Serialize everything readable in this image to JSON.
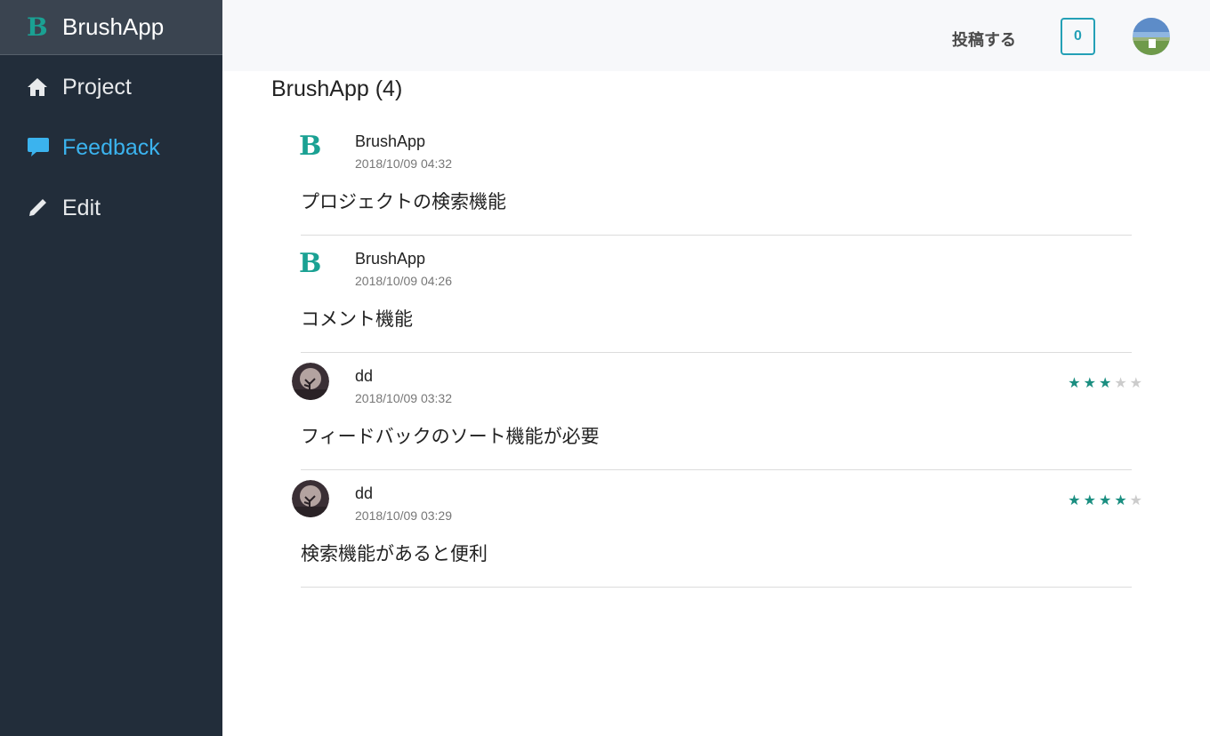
{
  "sidebar": {
    "brand": {
      "logo": "B",
      "name": "BrushApp"
    },
    "items": [
      {
        "label": "Project",
        "icon": "home-icon"
      },
      {
        "label": "Feedback",
        "icon": "chat-icon",
        "active": true
      },
      {
        "label": "Edit",
        "icon": "pencil-icon"
      }
    ]
  },
  "header": {
    "post_label": "投稿する",
    "counter": "0",
    "avatar_icon": "user-avatar"
  },
  "main": {
    "title": "BrushApp (4)",
    "feedback": [
      {
        "author": "BrushApp",
        "avatar": "B",
        "date": "2018/10/09 04:32",
        "text": "プロジェクトの検索機能",
        "rating": null
      },
      {
        "author": "BrushApp",
        "avatar": "B",
        "date": "2018/10/09 04:26",
        "text": "コメント機能",
        "rating": null
      },
      {
        "author": "dd",
        "avatar": "photo",
        "date": "2018/10/09 03:32",
        "text": "フィードバックのソート機能が必要",
        "rating": 3,
        "rating_max": 5
      },
      {
        "author": "dd",
        "avatar": "photo",
        "date": "2018/10/09 03:29",
        "text": "検索機能があると便利",
        "rating": 4,
        "rating_max": 5
      }
    ]
  },
  "colors": {
    "sidebar_bg": "#222d3a",
    "brand_teal": "#1aa193",
    "active_nav": "#3bb3ee",
    "counter_border": "#24a0b6",
    "star_on": "#1a8e80",
    "star_off": "#cccccc"
  }
}
